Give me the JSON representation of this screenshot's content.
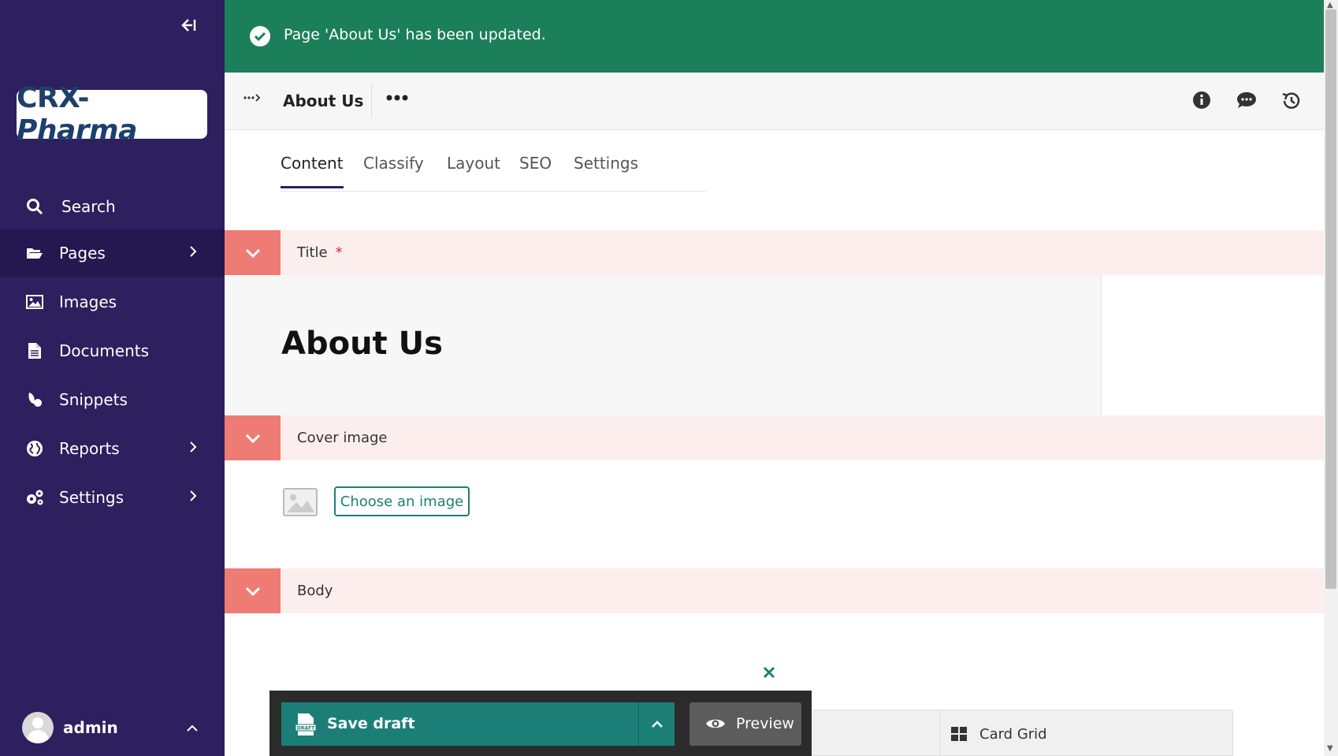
{
  "sidebar": {
    "logo": {
      "part1": "CRX-",
      "part2": "Pharma"
    },
    "collapse_icon": "collapse-left-icon",
    "items": [
      {
        "label": "Search",
        "icon": "search-icon",
        "has_submenu": false,
        "active": false
      },
      {
        "label": "Pages",
        "icon": "folder-open-icon",
        "has_submenu": true,
        "active": true
      },
      {
        "label": "Images",
        "icon": "image-icon",
        "has_submenu": false,
        "active": false
      },
      {
        "label": "Documents",
        "icon": "document-icon",
        "has_submenu": false,
        "active": false
      },
      {
        "label": "Snippets",
        "icon": "snippet-icon",
        "has_submenu": false,
        "active": false
      },
      {
        "label": "Reports",
        "icon": "globe-icon",
        "has_submenu": true,
        "active": false
      },
      {
        "label": "Settings",
        "icon": "cogs-icon",
        "has_submenu": true,
        "active": false
      }
    ],
    "user": {
      "name": "admin"
    }
  },
  "banner": {
    "message": "Page 'About Us' has been updated.",
    "color": "#1b7f5a"
  },
  "header": {
    "title": "About Us",
    "actions": [
      "info-icon",
      "comments-icon",
      "history-icon"
    ]
  },
  "tabs": [
    {
      "label": "Content",
      "active": true
    },
    {
      "label": "Classify",
      "active": false
    },
    {
      "label": "Layout",
      "active": false
    },
    {
      "label": "SEO",
      "active": false
    },
    {
      "label": "Settings",
      "active": false
    }
  ],
  "sections": {
    "title": {
      "label": "Title",
      "required_marker": "*",
      "value": "About Us"
    },
    "cover_image": {
      "label": "Cover image",
      "button": "Choose an image"
    },
    "body": {
      "label": "Body"
    }
  },
  "blocks": {
    "card_grid": "Card Grid"
  },
  "footer": {
    "save_label": "Save draft",
    "preview_label": "Preview"
  },
  "colors": {
    "sidebar_bg": "#2e1f5e",
    "accent_teal": "#1b7f78",
    "section_toggle": "#ef7b75",
    "section_bg": "#fdeeee"
  }
}
